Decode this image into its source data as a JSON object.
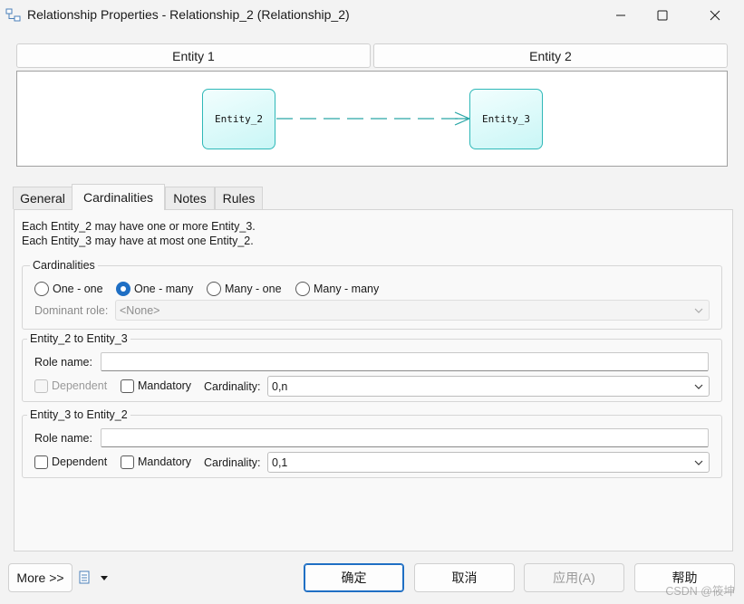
{
  "window": {
    "title": "Relationship Properties - Relationship_2 (Relationship_2)"
  },
  "entities": {
    "entity1_label": "Entity 1",
    "entity2_label": "Entity 2"
  },
  "diagram": {
    "left_entity": "Entity_2",
    "right_entity": "Entity_3"
  },
  "tabs": [
    {
      "label": "General",
      "active": false
    },
    {
      "label": "Cardinalities",
      "active": true
    },
    {
      "label": "Notes",
      "active": false
    },
    {
      "label": "Rules",
      "active": false
    }
  ],
  "description": {
    "line1": "Each Entity_2 may have one or more Entity_3.",
    "line2": "Each Entity_3 may have at most one Entity_2."
  },
  "cardinalities": {
    "legend": "Cardinalities",
    "options": [
      {
        "label": "One - one",
        "selected": false
      },
      {
        "label": "One - many",
        "selected": true
      },
      {
        "label": "Many - one",
        "selected": false
      },
      {
        "label": "Many - many",
        "selected": false
      }
    ],
    "dominant_role_label": "Dominant role:",
    "dominant_role_value": "<None>"
  },
  "role1": {
    "legend": "Entity_2 to Entity_3",
    "role_name_label": "Role name:",
    "role_name_value": "",
    "dependent_label": "Dependent",
    "dependent_checked": false,
    "dependent_enabled": false,
    "mandatory_label": "Mandatory",
    "mandatory_checked": false,
    "cardinality_label": "Cardinality:",
    "cardinality_value": "0,n"
  },
  "role2": {
    "legend": "Entity_3 to Entity_2",
    "role_name_label": "Role name:",
    "role_name_value": "",
    "dependent_label": "Dependent",
    "dependent_checked": false,
    "dependent_enabled": true,
    "mandatory_label": "Mandatory",
    "mandatory_checked": false,
    "cardinality_label": "Cardinality:",
    "cardinality_value": "0,1"
  },
  "footer": {
    "more_label": "More >>",
    "ok_label": "确定",
    "cancel_label": "取消",
    "apply_label": "应用(A)",
    "help_label": "帮助",
    "watermark": "CSDN @筱坤"
  },
  "colors": {
    "accent": "#1f6fc4",
    "entity_border": "#2fb8b8",
    "entity_fill": "#c9f6f6"
  }
}
